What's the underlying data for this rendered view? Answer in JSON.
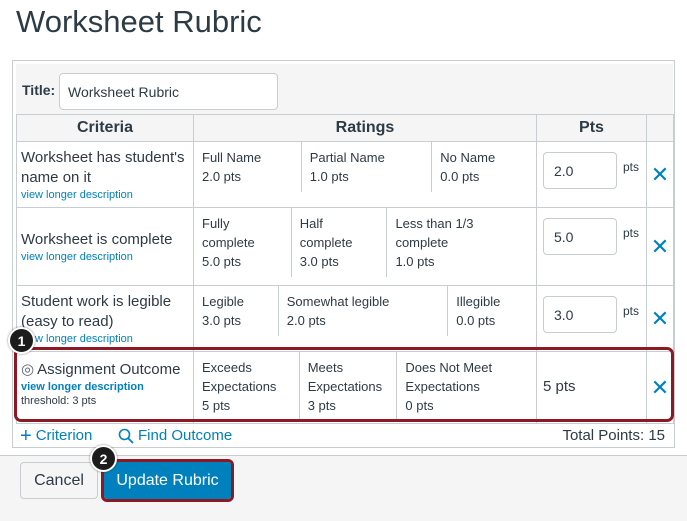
{
  "page_title": "Worksheet Rubric",
  "title_field": {
    "label": "Title:",
    "value": "Worksheet Rubric"
  },
  "headers": {
    "criteria": "Criteria",
    "ratings": "Ratings",
    "pts": "Pts"
  },
  "criteria": [
    {
      "name": "Worksheet has student's name on it",
      "link": "view longer description",
      "ratings": [
        {
          "title": "Full Name",
          "points": "2.0 pts"
        },
        {
          "title": "Partial Name",
          "points": "1.0 pts"
        },
        {
          "title": "No Name",
          "points": "0.0 pts"
        }
      ],
      "pts_value": "2.0",
      "pts_suffix": "pts"
    },
    {
      "name": "Worksheet is complete",
      "link": "view longer description",
      "ratings": [
        {
          "title": "Fully complete",
          "points": "5.0 pts"
        },
        {
          "title": "Half complete",
          "points": "3.0 pts"
        },
        {
          "title": "Less than 1/3 complete",
          "points": "1.0 pts"
        }
      ],
      "pts_value": "5.0",
      "pts_suffix": "pts"
    },
    {
      "name": "Student work is legible (easy to read)",
      "link": "view longer description",
      "ratings": [
        {
          "title": "Legible",
          "points": "3.0 pts"
        },
        {
          "title": "Somewhat legible",
          "points": "2.0 pts"
        },
        {
          "title": "Illegible",
          "points": "0.0 pts"
        }
      ],
      "pts_value": "3.0",
      "pts_suffix": "pts"
    },
    {
      "name": "Assignment Outcome",
      "link": "view longer description",
      "threshold": "threshold: 3 pts",
      "ratings": [
        {
          "title": "Exceeds Expectations",
          "points": "5 pts"
        },
        {
          "title": "Meets Expectations",
          "points": "3 pts"
        },
        {
          "title": "Does Not Meet Expectations",
          "points": "0 pts"
        }
      ],
      "pts_static": "5 pts"
    }
  ],
  "actions": {
    "add_criterion": "Criterion",
    "find_outcome": "Find Outcome",
    "total_points": "Total Points: 15"
  },
  "footer": {
    "cancel": "Cancel",
    "update": "Update Rubric"
  },
  "callouts": {
    "one": "1",
    "two": "2"
  },
  "colors": {
    "link": "#0081bd",
    "highlight": "#8b1a24",
    "primary": "#0081bd"
  }
}
